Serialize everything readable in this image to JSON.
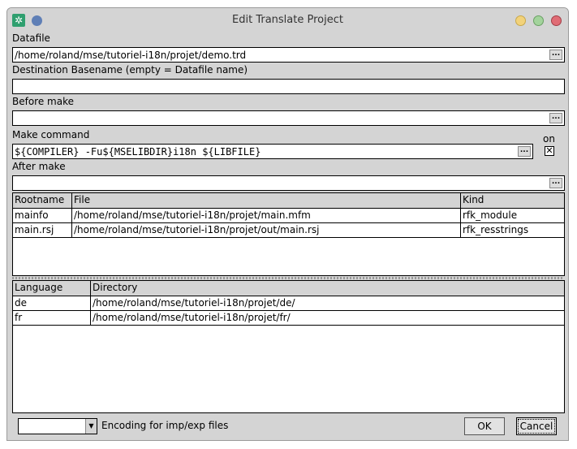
{
  "window": {
    "title": "Edit Translate Project"
  },
  "datafile": {
    "label": "Datafile",
    "value": "/home/roland/mse/tutoriel-i18n/projet/demo.trd",
    "browse": "..."
  },
  "destination": {
    "label": "Destination Basename (empty = Datafile name)",
    "value": ""
  },
  "before_make": {
    "label": "Before make",
    "value": "",
    "browse": "..."
  },
  "make_command": {
    "label": "Make command",
    "value": "${COMPILER} -Fu${MSELIBDIR}i18n ${LIBFILE}",
    "browse": "...",
    "on_label": "on",
    "on_checked": true,
    "check_mark": "✕"
  },
  "after_make": {
    "label": "After make",
    "value": "",
    "browse": "..."
  },
  "files_table": {
    "headers": [
      "Rootname",
      "File",
      "Kind"
    ],
    "rows": [
      [
        "mainfo",
        "/home/roland/mse/tutoriel-i18n/projet/main.mfm",
        "rfk_module"
      ],
      [
        "main.rsj",
        "/home/roland/mse/tutoriel-i18n/projet/out/main.rsj",
        "rfk_resstrings"
      ]
    ]
  },
  "lang_table": {
    "headers": [
      "Language",
      "Directory"
    ],
    "rows": [
      [
        "de",
        "/home/roland/mse/tutoriel-i18n/projet/de/"
      ],
      [
        "fr",
        "/home/roland/mse/tutoriel-i18n/projet/fr/"
      ]
    ]
  },
  "footer": {
    "encoding_value": "",
    "encoding_label": "Encoding for imp/exp files",
    "ok": "OK",
    "cancel": "Cancel"
  }
}
